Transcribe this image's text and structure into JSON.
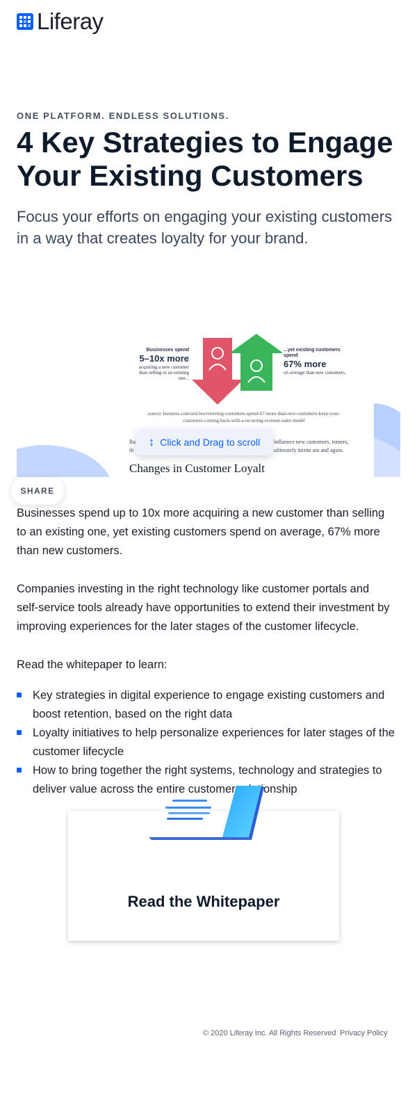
{
  "header": {
    "logo_text": "Liferay"
  },
  "hero": {
    "eyebrow": "ONE PLATFORM. ENDLESS SOLUTIONS.",
    "title": "4 Key Strategies to Engage Your Existing Customers",
    "subtitle": "Focus your efforts on engaging your existing customers in a way that creates loyalty for your brand."
  },
  "preview": {
    "stat_left": {
      "pre": "Businesses spend",
      "big": "5–10x more",
      "post": "acquiring a new customer than selling to an existing one..."
    },
    "stat_right": {
      "pre": "...yet existing customers spend",
      "big": "67% more",
      "post": "on average than new customers."
    },
    "source": "source: business.com/articles/returning-customers-spend-67-more-than-new-customers-keep-your-customers-coming-back-with-a-recurring-revenue-sales-model",
    "text_left": "Ra bu th",
    "text_right": "influence new customers, tomers, ultimately turnin ain and again.",
    "heading_partial": "Changes in Customer Loyalt",
    "scroll_hint": "Click and Drag to scroll"
  },
  "share_label": "SHARE",
  "body": {
    "p1": "Businesses spend up to 10x more acquiring a new customer than selling to an existing one, yet existing customers spend on average, 67% more than new customers.",
    "p2": "Companies investing in the right technology like customer portals and self-service tools already have opportunities to extend their investment by improving experiences for the later stages of the customer lifecycle.",
    "p3": "Read the whitepaper to learn:",
    "bullets": [
      "Key strategies in digital experience to engage existing customers and boost retention, based on the right data",
      "Loyalty initiatives to help personalize experiences for later stages of the customer lifecycle",
      "How to bring together the right systems, technology and strategies to deliver value across the entire customer relationship"
    ]
  },
  "cta": {
    "title": "Read the Whitepaper"
  },
  "footer": {
    "copyright": "© 2020 Liferay Inc. All Rights Reserved",
    "privacy": "Privacy Policy"
  },
  "colors": {
    "accent": "#0b5fff",
    "arrow_red": "#e05668",
    "arrow_green": "#3bb55b"
  }
}
